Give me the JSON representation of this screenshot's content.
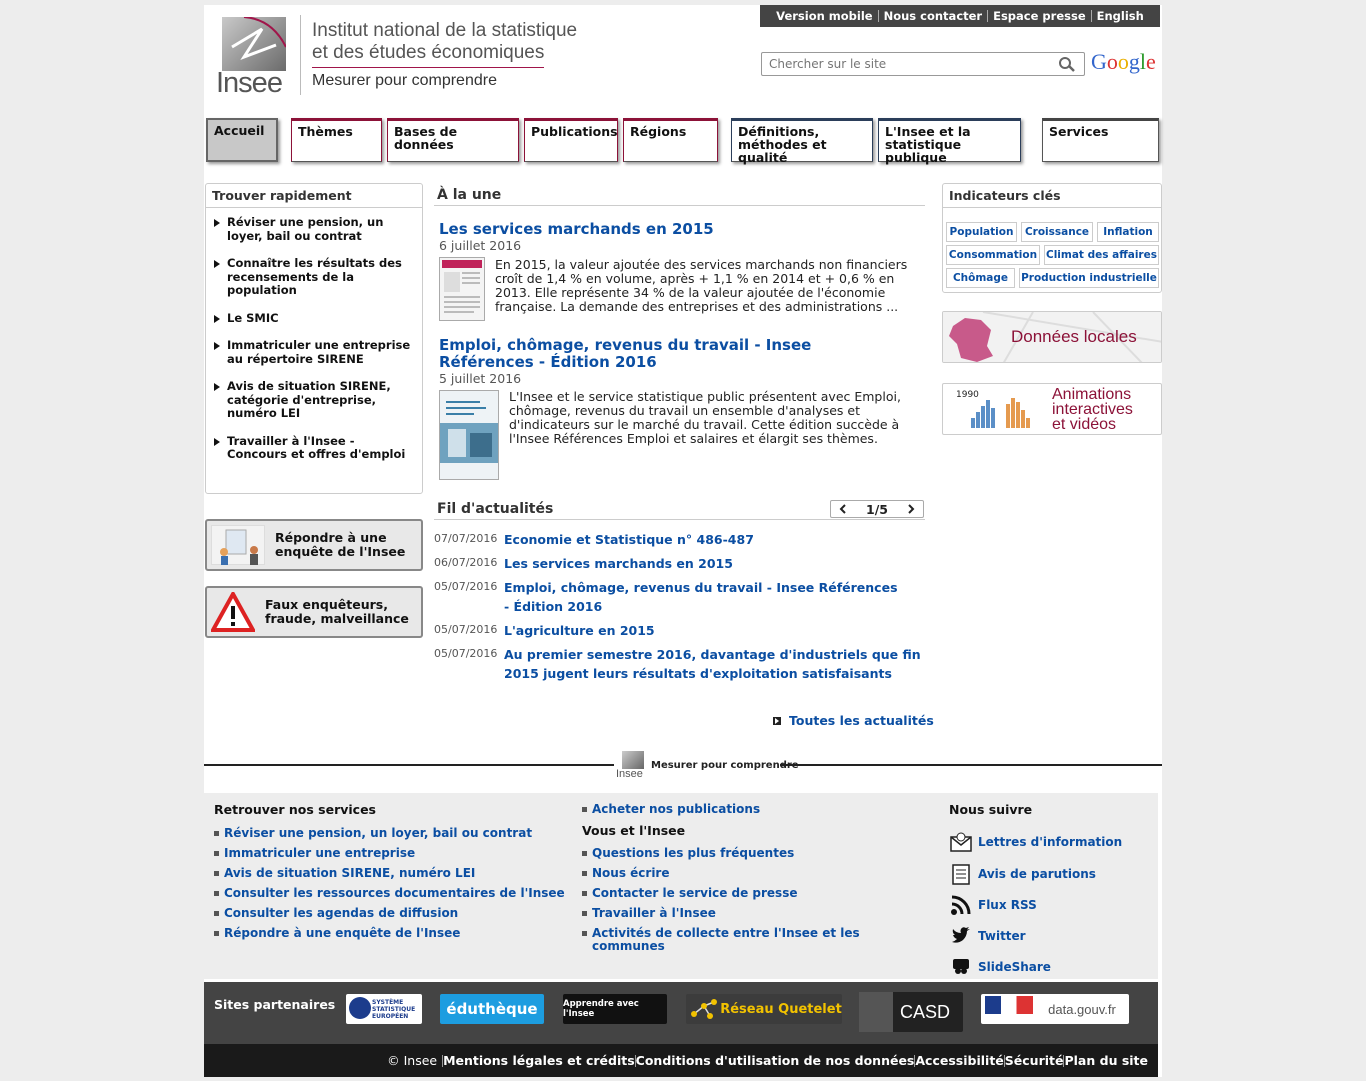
{
  "header": {
    "logo_word": "Insee",
    "institution_line1": "Institut national de la statistique",
    "institution_line2": "et des études économiques",
    "slogan": "Mesurer pour comprendre",
    "top_links": [
      "Version mobile",
      "Nous contacter",
      "Espace presse",
      "English"
    ],
    "search_placeholder": "Chercher sur le site",
    "google_label": "Google"
  },
  "nav": {
    "accueil": "Accueil",
    "themes": "Thèmes",
    "bases": "Bases de données",
    "publications": "Publications",
    "regions": "Régions",
    "definitions": "Définitions, méthodes et qualité",
    "insee_stat": "L'Insee et la statistique publique",
    "services": "Services"
  },
  "quick_find": {
    "title": "Trouver rapidement",
    "items": [
      "Réviser une pension, un loyer, bail ou contrat",
      "Connaître les résultats des recensements de la population",
      "Le SMIC",
      "Immatriculer une entreprise au répertoire SIRENE",
      "Avis de situation SIRENE, catégorie d'entreprise, numéro LEI",
      "Travailler à l'Insee - Concours et offres d'emploi"
    ]
  },
  "side_buttons": {
    "survey": "Répondre à une enquête de l'Insee",
    "fraud": "Faux enquêteurs, fraude, malveillance"
  },
  "a_la_une": {
    "title": "À la une",
    "items": [
      {
        "title": "Les services marchands en 2015",
        "date": "6 juillet 2016",
        "text": "En 2015, la valeur ajoutée des services marchands non financiers croît de 1,4 % en volume, après + 1,1 % en 2014 et + 0,6 % en 2013. Elle représente 34 % de la valeur ajoutée de l'économie française. La demande des entreprises et des administrations ..."
      },
      {
        "title": "Emploi, chômage, revenus du travail - Insee Références - Édition 2016",
        "date": "5 juillet 2016",
        "text": "L'Insee et le service statistique public présentent avec Emploi, chômage, revenus du travail un ensemble d'analyses et d'indicateurs sur le marché du travail. Cette édition succède à l'Insee Références Emploi et salaires et élargit ses thèmes."
      }
    ]
  },
  "fil": {
    "title": "Fil d'actualités",
    "pager": "1/5",
    "items": [
      {
        "date": "07/07/2016",
        "text": "Economie et Statistique n° 486-487"
      },
      {
        "date": "06/07/2016",
        "text": "Les services marchands en 2015"
      },
      {
        "date": "05/07/2016",
        "text": "Emploi, chômage, revenus du travail - Insee Références - Édition 2016"
      },
      {
        "date": "05/07/2016",
        "text": "L'agriculture en 2015"
      },
      {
        "date": "05/07/2016",
        "text": "Au premier semestre 2016, davantage d'industriels que fin 2015 jugent leurs résultats d'exploitation satisfaisants"
      }
    ],
    "all_news": "Toutes les actualités"
  },
  "indicators": {
    "title": "Indicateurs clés",
    "chips": [
      "Population",
      "Croissance",
      "Inflation",
      "Consommation",
      "Climat des affaires",
      "Chômage",
      "Production industrielle"
    ]
  },
  "promos": {
    "local": "Données locales",
    "anim1": "Animations",
    "anim2": "interactives",
    "anim3": "et vidéos",
    "year": "1990"
  },
  "footer": {
    "slogan": "Mesurer pour comprendre",
    "logo_word": "Insee",
    "services_title": "Retrouver nos services",
    "services": [
      "Réviser une pension, un loyer, bail ou contrat",
      "Immatriculer une entreprise",
      "Avis de situation SIRENE, numéro LEI",
      "Consulter les ressources documentaires de l'Insee",
      "Consulter les agendas de diffusion",
      "Répondre à une enquête de l'Insee"
    ],
    "buy": "Acheter nos publications",
    "vous_title": "Vous et l'Insee",
    "vous": [
      "Questions les plus fréquentes",
      "Nous écrire",
      "Contacter le service de presse",
      "Travailler à l'Insee",
      "Activités de collecte entre l'Insee et les communes"
    ],
    "follow_title": "Nous suivre",
    "follow": [
      "Lettres d'information",
      "Avis de parutions",
      "Flux RSS",
      "Twitter",
      "SlideShare"
    ],
    "partners_title": "Sites partenaires",
    "partners": [
      "SYSTÈME STATISTIQUE EUROPÉEN",
      "éduthèque",
      "Apprendre avec l'Insee",
      "Réseau Quetelet",
      "CASD",
      "data.gouv.fr"
    ],
    "bottom_links": [
      "© Insee",
      "Mentions légales et crédits",
      "Conditions d'utilisation de nos données",
      "Accessibilité",
      "Sécurité",
      "Plan du site"
    ]
  },
  "colors": {
    "link": "#0b4ea2",
    "brand_red": "#8c1238",
    "nav_blue": "#2b3e5a",
    "dark_bar": "#444444"
  }
}
